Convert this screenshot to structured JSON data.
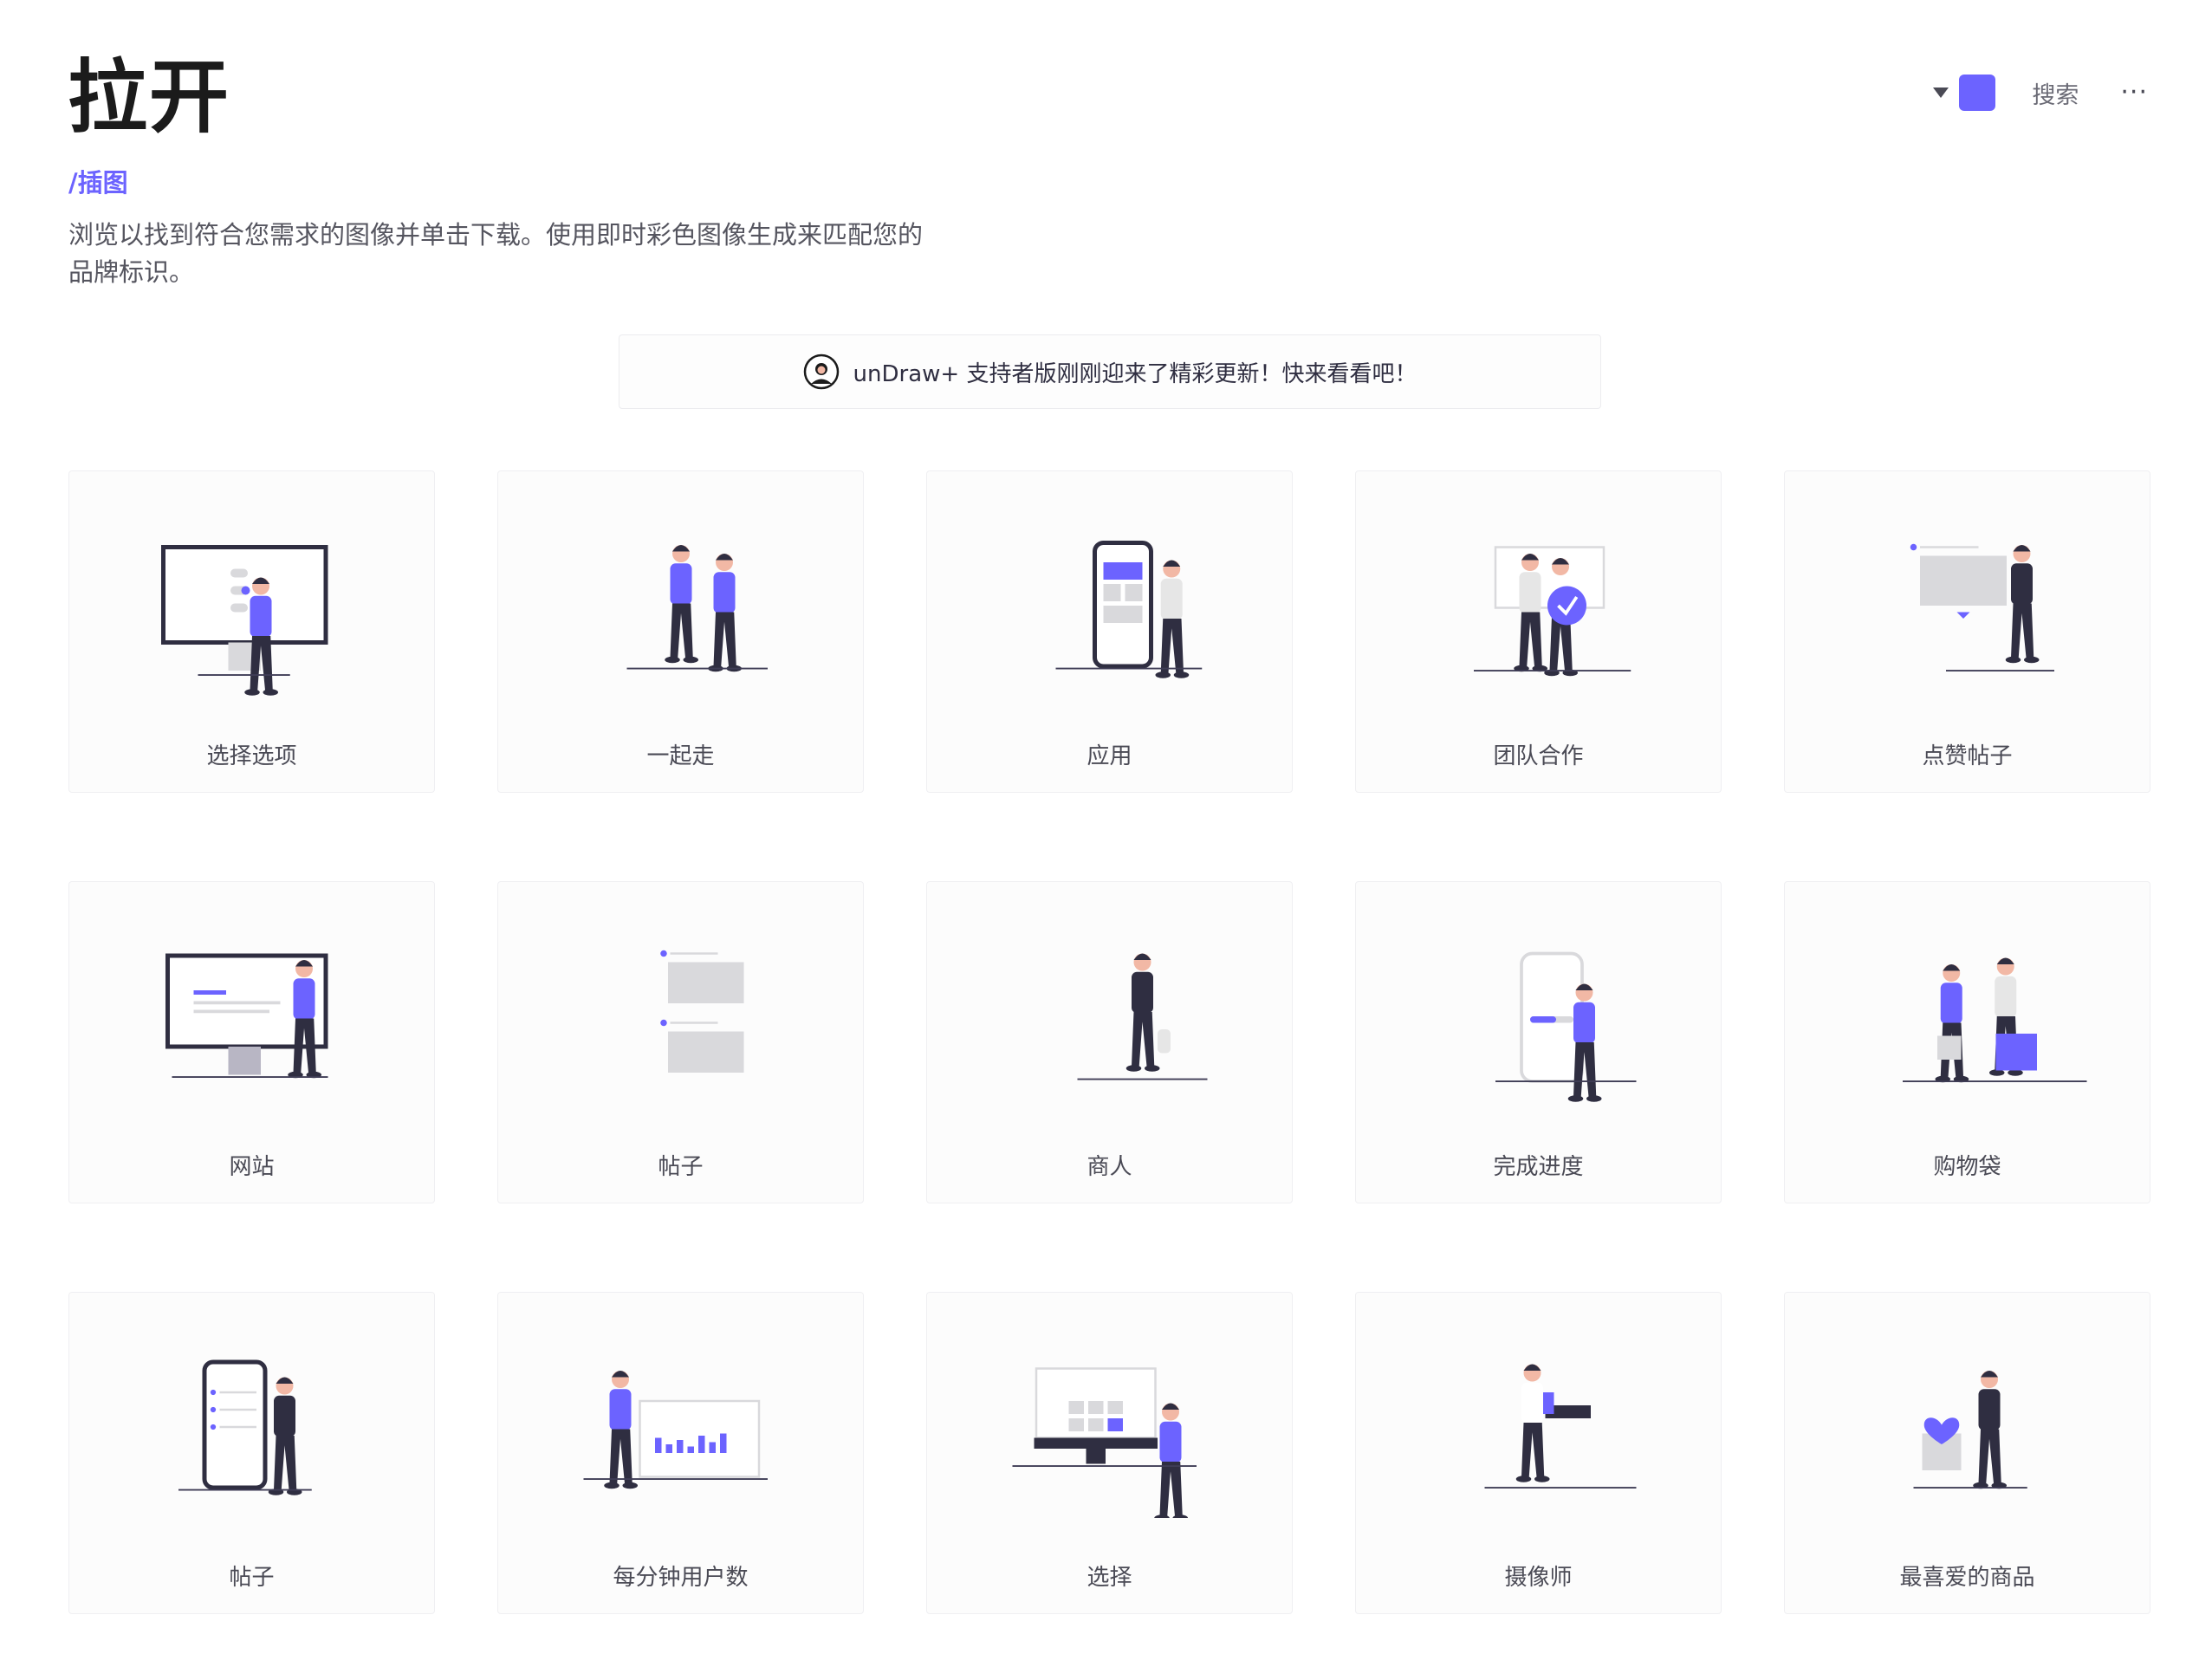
{
  "header": {
    "title": "拉开",
    "breadcrumb": "/插图",
    "description": "浏览以找到符合您需求的图像并单击下载。使用即时彩色图像生成来匹配您的品牌标识。"
  },
  "toolbar": {
    "color_dropdown_icon": "caret-down-icon",
    "accent_color": "#6c63ff",
    "search_label": "搜索",
    "more_label": "···"
  },
  "banner": {
    "text": "unDraw+ 支持者版刚刚迎来了精彩更新！快来看看吧！",
    "icon": "avatar-icon"
  },
  "colors": {
    "accent": "#6c63ff",
    "dark": "#2f2e41",
    "gray": "#d9d9dc",
    "skin": "#f2b8a5"
  },
  "illustrations": [
    {
      "label": "选择选项",
      "kind": "monitor-toggle"
    },
    {
      "label": "一起走",
      "kind": "walk-together"
    },
    {
      "label": "应用",
      "kind": "phone-app"
    },
    {
      "label": "团队合作",
      "kind": "teamwork"
    },
    {
      "label": "点赞帖子",
      "kind": "like-post"
    },
    {
      "label": "网站",
      "kind": "website"
    },
    {
      "label": "帖子",
      "kind": "posts"
    },
    {
      "label": "商人",
      "kind": "businessman"
    },
    {
      "label": "完成进度",
      "kind": "progress"
    },
    {
      "label": "购物袋",
      "kind": "shopping"
    },
    {
      "label": "帖子",
      "kind": "phone-posts"
    },
    {
      "label": "每分钟用户数",
      "kind": "users-per-minute"
    },
    {
      "label": "选择",
      "kind": "choose"
    },
    {
      "label": "摄像师",
      "kind": "cameraman"
    },
    {
      "label": "最喜爱的商品",
      "kind": "favorite"
    }
  ]
}
